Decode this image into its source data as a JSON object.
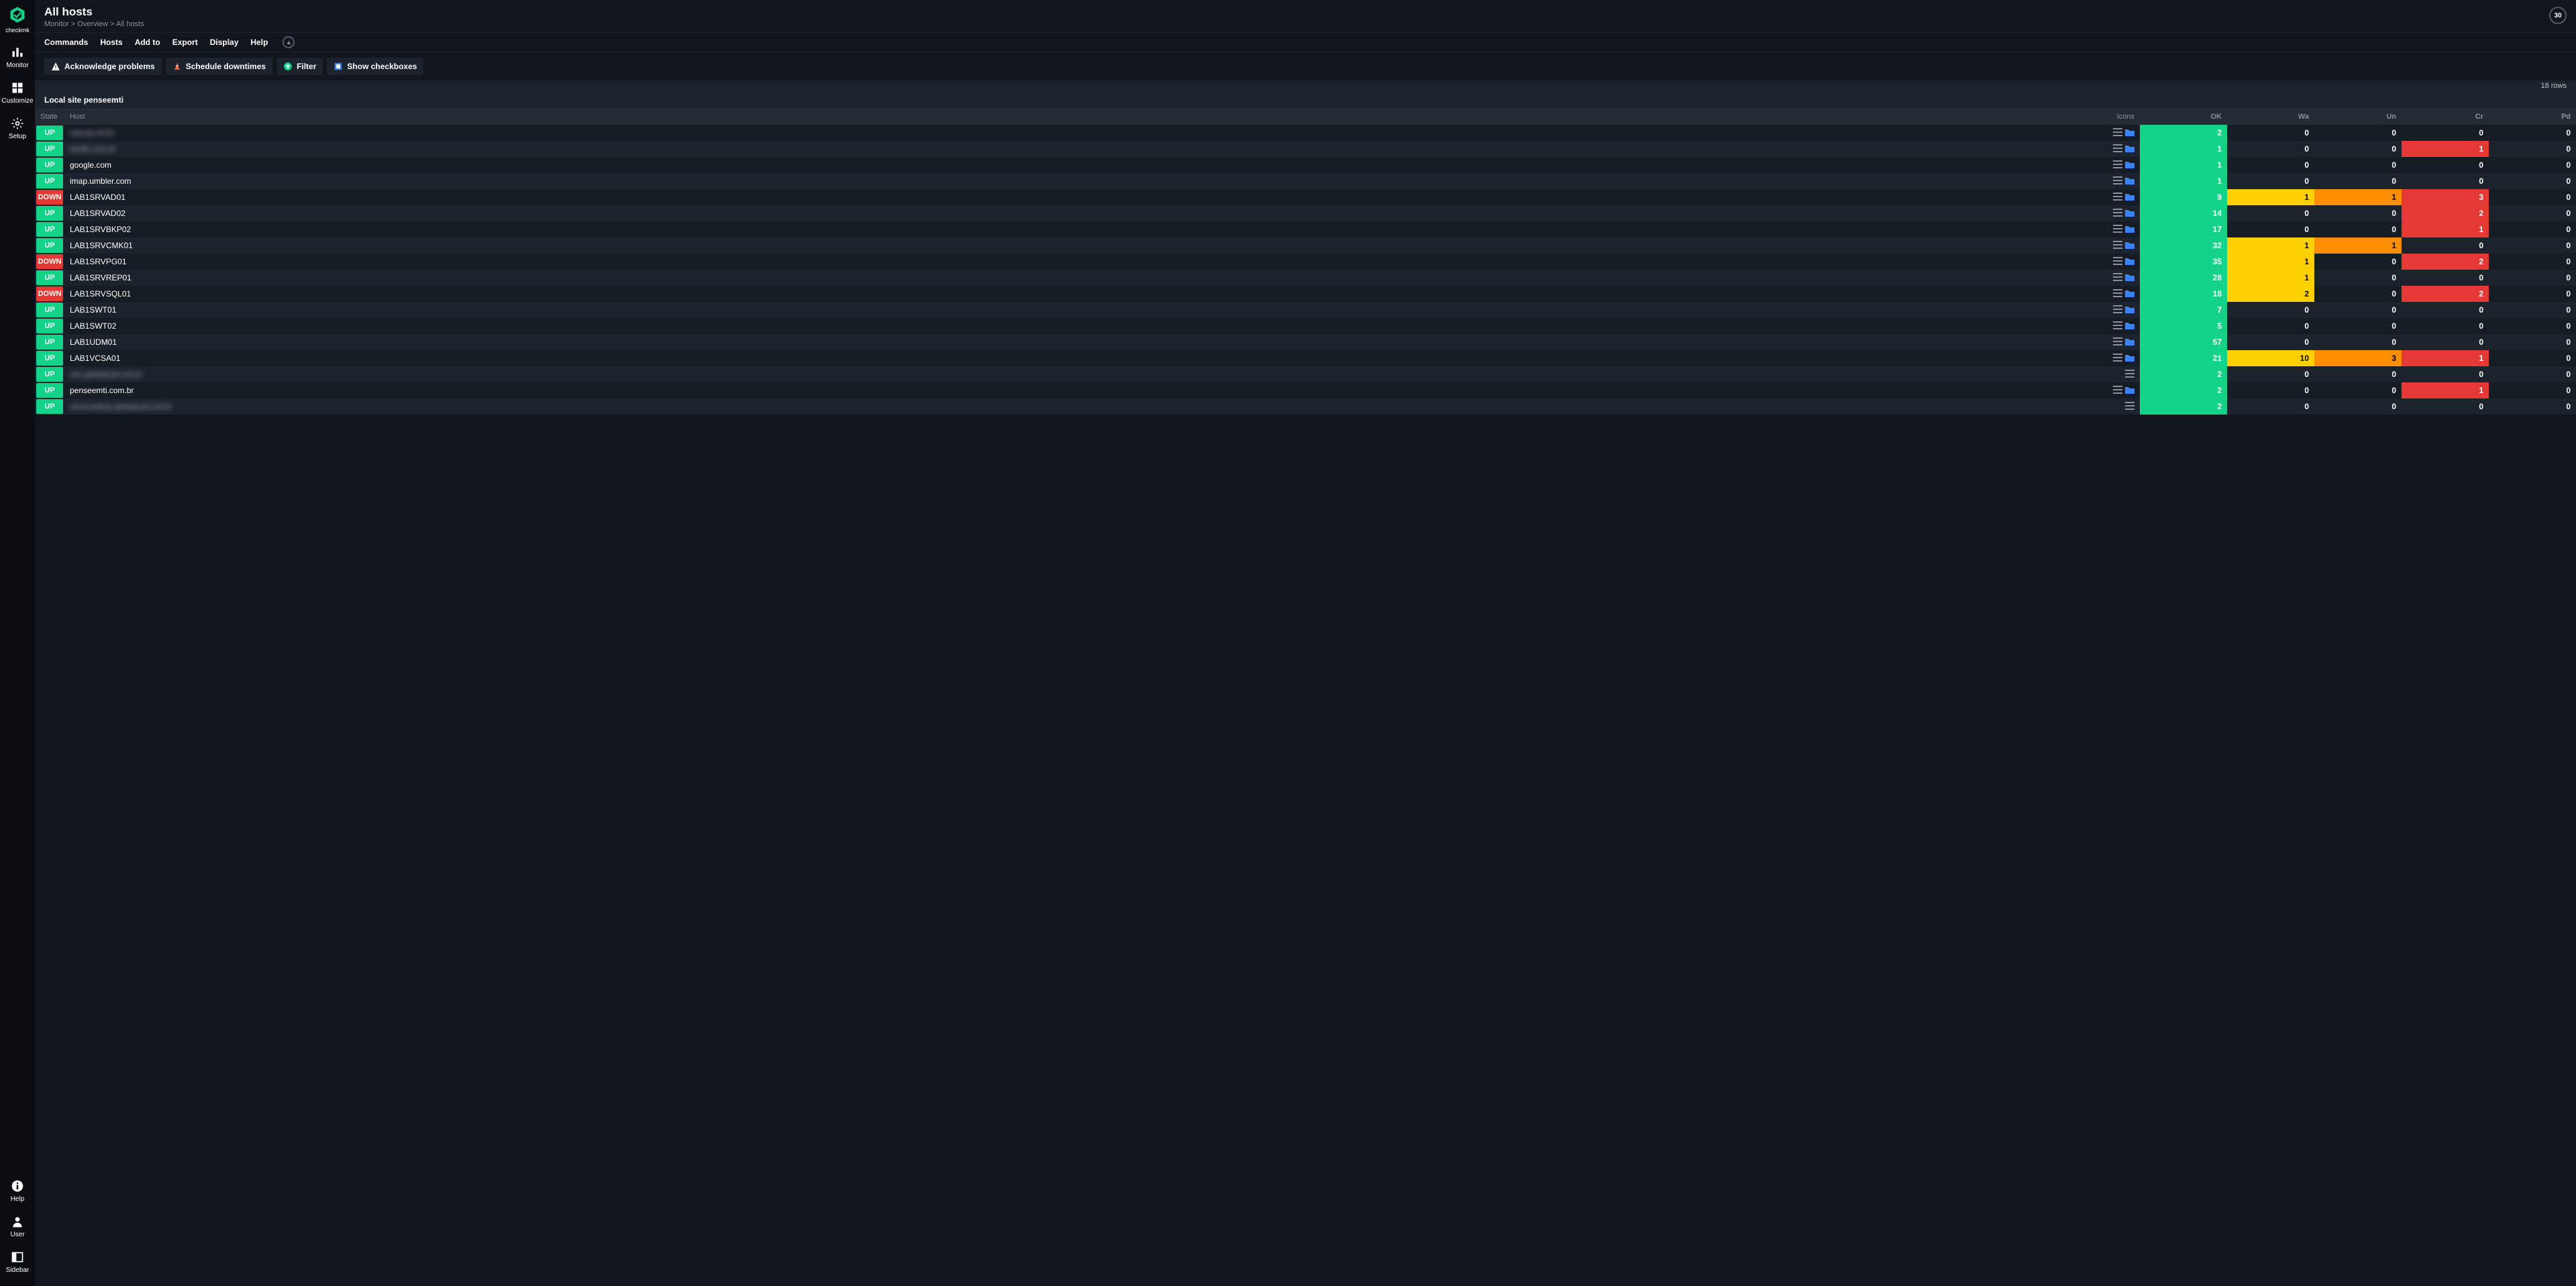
{
  "brand": "checkmk",
  "sidebar": {
    "top": [
      {
        "label": "Monitor"
      },
      {
        "label": "Customize"
      },
      {
        "label": "Setup"
      }
    ],
    "bottom": [
      {
        "label": "Help"
      },
      {
        "label": "User"
      },
      {
        "label": "Sidebar"
      }
    ]
  },
  "header": {
    "title": "All hosts",
    "breadcrumb": [
      "Monitor",
      "Overview",
      "All hosts"
    ]
  },
  "menu": [
    "Commands",
    "Hosts",
    "Add to",
    "Export",
    "Display",
    "Help"
  ],
  "refresh": "30",
  "toolbar": {
    "ack": "Acknowledge problems",
    "sched": "Schedule downtimes",
    "filter": "Filter",
    "showcb": "Show checkboxes"
  },
  "rowcount": "18 rows",
  "section": "Local site penseemti",
  "columns": {
    "state": "State",
    "host": "Host",
    "icons": "Icons",
    "ok": "OK",
    "wa": "Wa",
    "un": "Un",
    "cr": "Cr",
    "pd": "Pd"
  },
  "hosts": [
    {
      "state": "UP",
      "name": "sacorp.inf.br",
      "blur": true,
      "folder": true,
      "ok": 2,
      "wa": 0,
      "un": 0,
      "cr": 0,
      "pd": 0
    },
    {
      "state": "UP",
      "name": "bw48.com.br",
      "blur": true,
      "folder": true,
      "ok": 1,
      "wa": 0,
      "un": 0,
      "cr": 1,
      "pd": 0
    },
    {
      "state": "UP",
      "name": "google.com",
      "blur": false,
      "folder": true,
      "ok": 1,
      "wa": 0,
      "un": 0,
      "cr": 0,
      "pd": 0
    },
    {
      "state": "UP",
      "name": "imap.umbler.com",
      "blur": false,
      "folder": true,
      "ok": 1,
      "wa": 0,
      "un": 0,
      "cr": 0,
      "pd": 0
    },
    {
      "state": "DOWN",
      "name": "LAB1SRVAD01",
      "blur": false,
      "folder": true,
      "ok": 9,
      "wa": 1,
      "un": 1,
      "cr": 3,
      "pd": 0
    },
    {
      "state": "UP",
      "name": "LAB1SRVAD02",
      "blur": false,
      "folder": true,
      "ok": 14,
      "wa": 0,
      "un": 0,
      "cr": 2,
      "pd": 0
    },
    {
      "state": "UP",
      "name": "LAB1SRVBKP02",
      "blur": false,
      "folder": true,
      "ok": 17,
      "wa": 0,
      "un": 0,
      "cr": 1,
      "pd": 0
    },
    {
      "state": "UP",
      "name": "LAB1SRVCMK01",
      "blur": false,
      "folder": true,
      "ok": 32,
      "wa": 1,
      "un": 1,
      "cr": 0,
      "pd": 0
    },
    {
      "state": "DOWN",
      "name": "LAB1SRVPG01",
      "blur": false,
      "folder": true,
      "ok": 35,
      "wa": 1,
      "un": 0,
      "cr": 2,
      "pd": 0
    },
    {
      "state": "UP",
      "name": "LAB1SRVREP01",
      "blur": false,
      "folder": true,
      "ok": 28,
      "wa": 1,
      "un": 0,
      "cr": 0,
      "pd": 0
    },
    {
      "state": "DOWN",
      "name": "LAB1SRVSQL01",
      "blur": false,
      "folder": true,
      "ok": 18,
      "wa": 2,
      "un": 0,
      "cr": 2,
      "pd": 0
    },
    {
      "state": "UP",
      "name": "LAB1SWT01",
      "blur": false,
      "folder": true,
      "ok": 7,
      "wa": 0,
      "un": 0,
      "cr": 0,
      "pd": 0
    },
    {
      "state": "UP",
      "name": "LAB1SWT02",
      "blur": false,
      "folder": true,
      "ok": 5,
      "wa": 0,
      "un": 0,
      "cr": 0,
      "pd": 0
    },
    {
      "state": "UP",
      "name": "LAB1UDM01",
      "blur": false,
      "folder": true,
      "ok": 57,
      "wa": 0,
      "un": 0,
      "cr": 0,
      "pd": 0
    },
    {
      "state": "UP",
      "name": "LAB1VCSA01",
      "blur": false,
      "folder": true,
      "ok": 21,
      "wa": 10,
      "un": 3,
      "cr": 1,
      "pd": 0
    },
    {
      "state": "UP",
      "name": "noc.globalcare.inf.br",
      "blur": true,
      "folder": false,
      "ok": 2,
      "wa": 0,
      "un": 0,
      "cr": 0,
      "pd": 0
    },
    {
      "state": "UP",
      "name": "penseemti.com.br",
      "blur": false,
      "folder": true,
      "ok": 2,
      "wa": 0,
      "un": 0,
      "cr": 1,
      "pd": 0
    },
    {
      "state": "UP",
      "name": "servicedesk.globalcare.inf.br",
      "blur": true,
      "folder": false,
      "ok": 2,
      "wa": 0,
      "un": 0,
      "cr": 0,
      "pd": 0
    }
  ]
}
